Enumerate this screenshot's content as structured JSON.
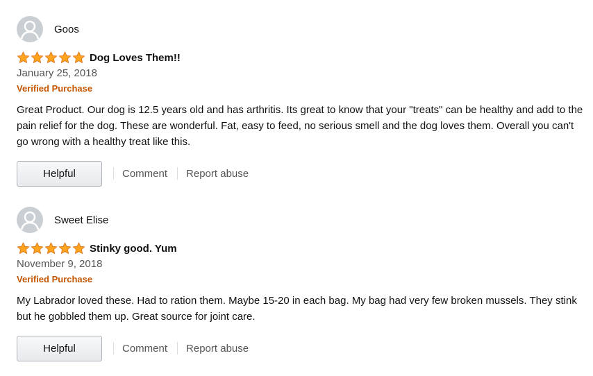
{
  "reviews": [
    {
      "profile_name": "Goos",
      "rating": 5,
      "title": "Dog Loves Them!!",
      "date": "January 25, 2018",
      "verified_label": "Verified Purchase",
      "body": "Great Product. Our dog is 12.5 years old and has arthritis. Its great to know that your \"treats\" can be healthy and add to the pain relief for the dog. These are wonderful. Fat, easy to feed, no serious smell and the dog loves them. Overall you can't go wrong with a healthy treat like this.",
      "helpful_label": "Helpful",
      "comment_label": "Comment",
      "report_label": "Report abuse"
    },
    {
      "profile_name": "Sweet Elise",
      "rating": 5,
      "title": "Stinky good. Yum",
      "date": "November 9, 2018",
      "verified_label": "Verified Purchase",
      "body": "My Labrador loved these. Had to ration them. Maybe 15-20 in each bag. My bag had very few broken mussels. They stink but he gobbled them up. Great source for joint care.",
      "helpful_label": "Helpful",
      "comment_label": "Comment",
      "report_label": "Report abuse"
    }
  ],
  "icons": {
    "avatar": "default-avatar-icon",
    "star": "star-icon"
  },
  "colors": {
    "star_fill": "#ffa41c",
    "star_stroke": "#de7921",
    "verified": "#c45500",
    "avatar_bg": "#c9cfd3"
  }
}
